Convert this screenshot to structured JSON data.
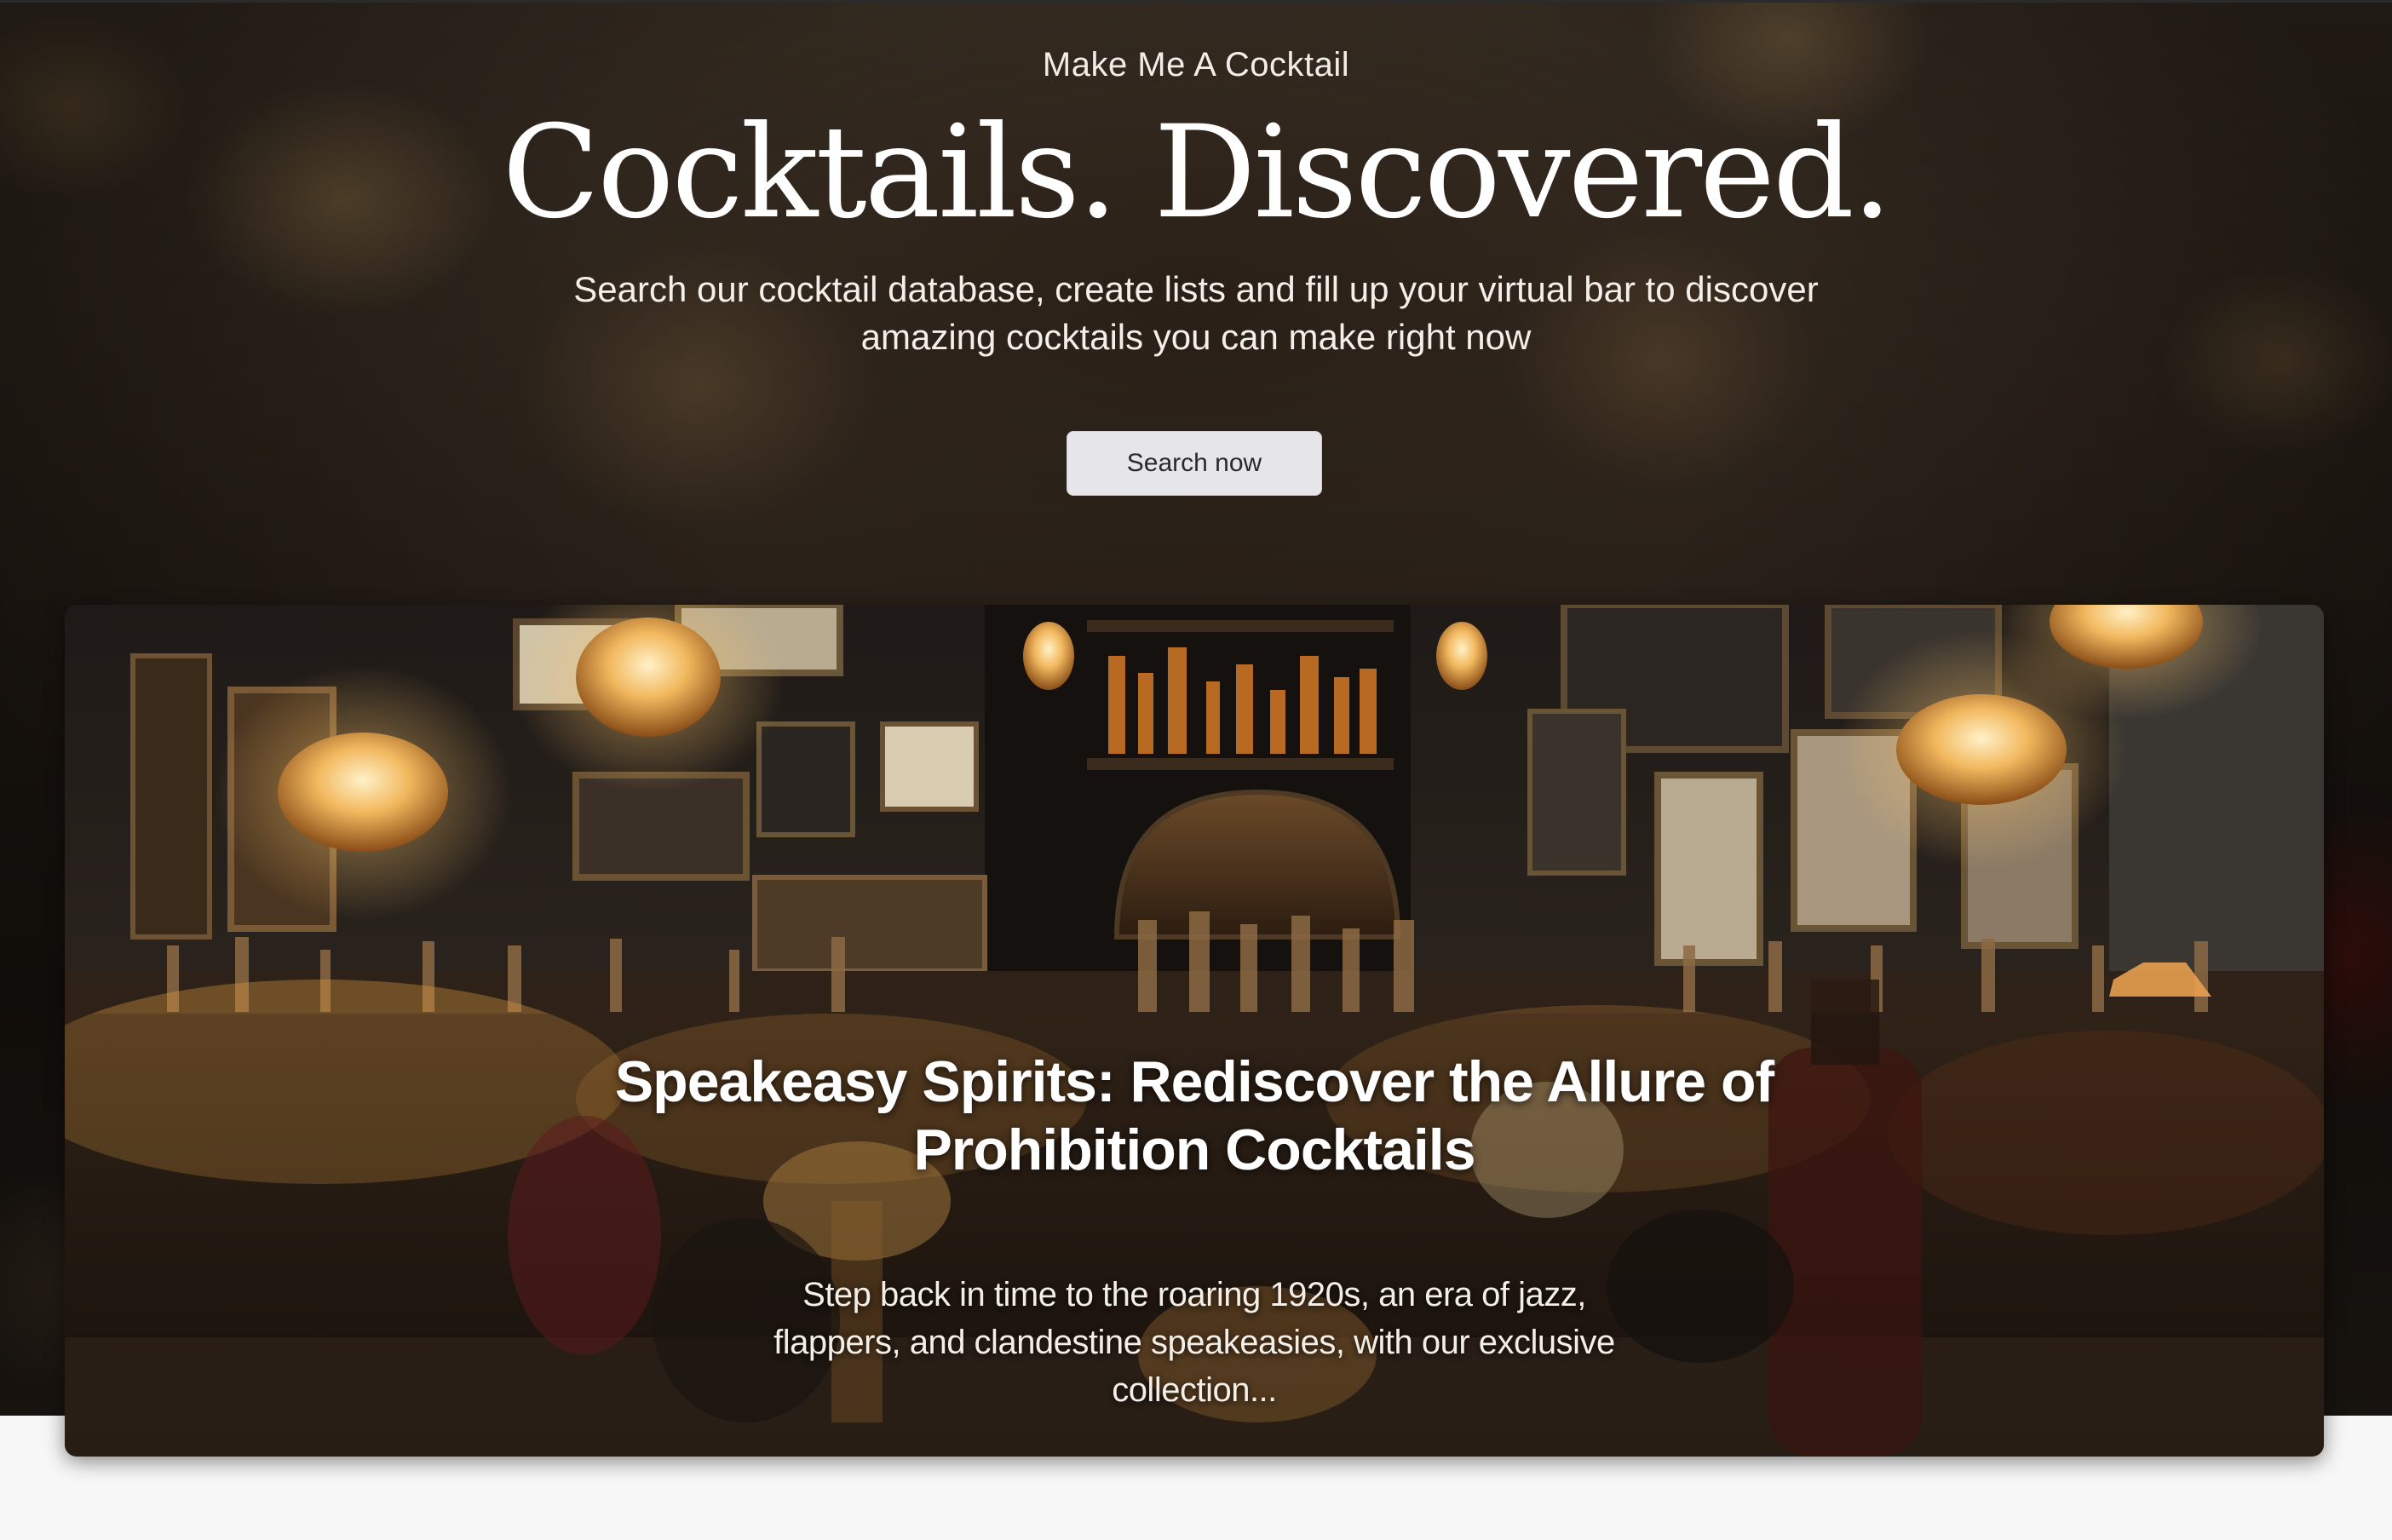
{
  "hero": {
    "eyebrow": "Make Me A Cocktail",
    "headline": "Cocktails. Discovered.",
    "lede": "Search our cocktail database, create lists and fill up your virtual bar to discover amazing cocktails you can make right now",
    "search_button_label": "Search now"
  },
  "featured_article": {
    "title": "Speakeasy Spirits: Rediscover the Allure of Prohibition Cocktails",
    "excerpt": "Step back in time to the roaring 1920s, an era of jazz, flappers, and clandestine speakeasies, with our exclusive collection..."
  },
  "colors": {
    "hero_dark": "#1e1812",
    "amber_glow": "#e8b46a",
    "button_bg": "#e6e6ea",
    "page_bg": "#f7f7f7"
  }
}
